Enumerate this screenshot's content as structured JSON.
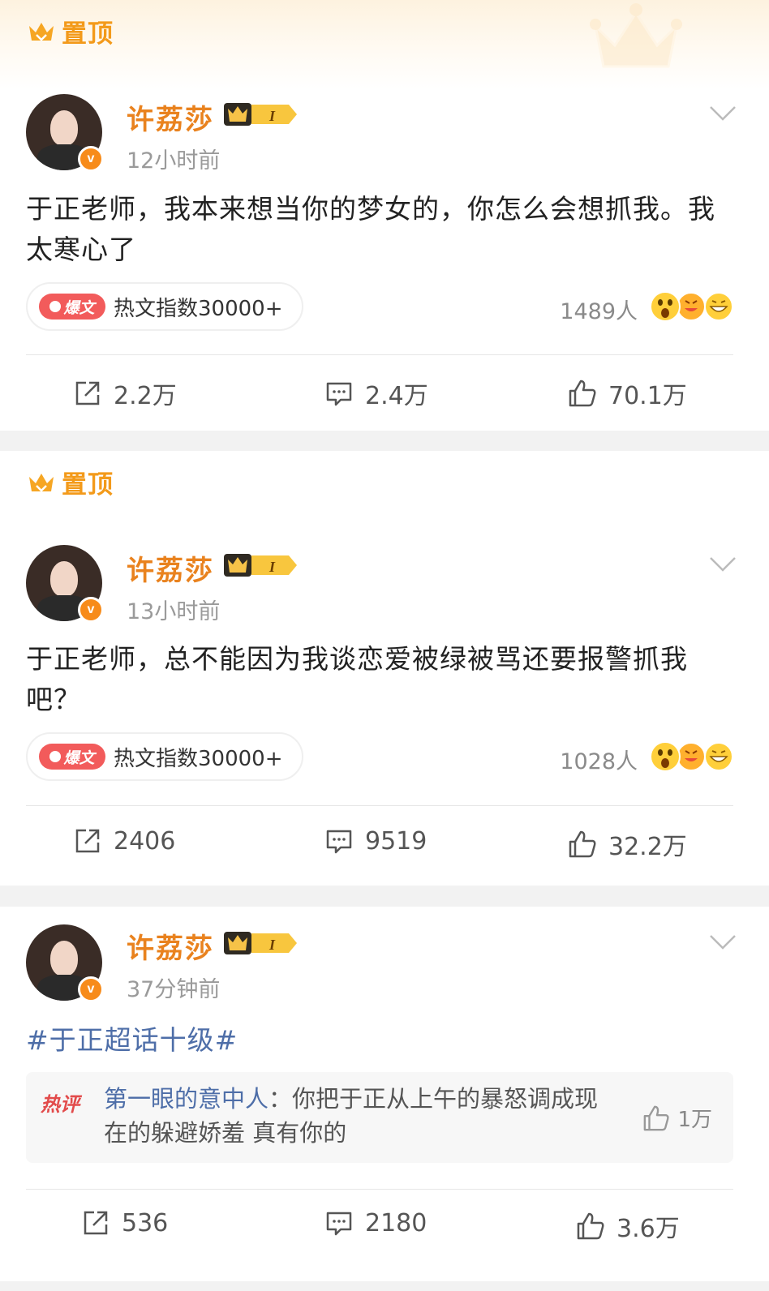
{
  "pinned_label": "置顶",
  "posts": [
    {
      "username": "许荔莎",
      "vip_level": "I",
      "time": "12小时前",
      "content": "于正老师，我本来想当你的梦女的，你怎么会想抓我。我太寒心了",
      "hot_badge": "爆文",
      "hot_index": "热文指数30000+",
      "reactions": "1489人",
      "repost": "2.2万",
      "comment": "2.4万",
      "like": "70.1万"
    },
    {
      "username": "许荔莎",
      "vip_level": "I",
      "time": "13小时前",
      "content": "于正老师，总不能因为我谈恋爱被绿被骂还要报警抓我吧？",
      "hot_badge": "爆文",
      "hot_index": "热文指数30000+",
      "reactions": "1028人",
      "repost": "2406",
      "comment": "9519",
      "like": "32.2万"
    },
    {
      "username": "许荔莎",
      "vip_level": "I",
      "time": "37分钟前",
      "hashtag": "#于正超话十级#",
      "hot_comment": {
        "tag": "热评",
        "author": "第一眼的意中人",
        "text": "：你把于正从上午的暴怒调成现在的躲避娇羞 真有你的",
        "likes": "1万"
      },
      "repost": "536",
      "comment": "2180",
      "like": "3.6万"
    }
  ],
  "colors": {
    "pinned": "#f39a1a",
    "username": "#e9821e",
    "link": "#4e6ea8",
    "hot_badge": "#f25b5b"
  },
  "icons": [
    "crown-icon",
    "chevron-down-icon",
    "repost-icon",
    "comment-icon",
    "like-icon",
    "verified-icon",
    "emoji-shocked-icon",
    "emoji-laugh-icon"
  ]
}
